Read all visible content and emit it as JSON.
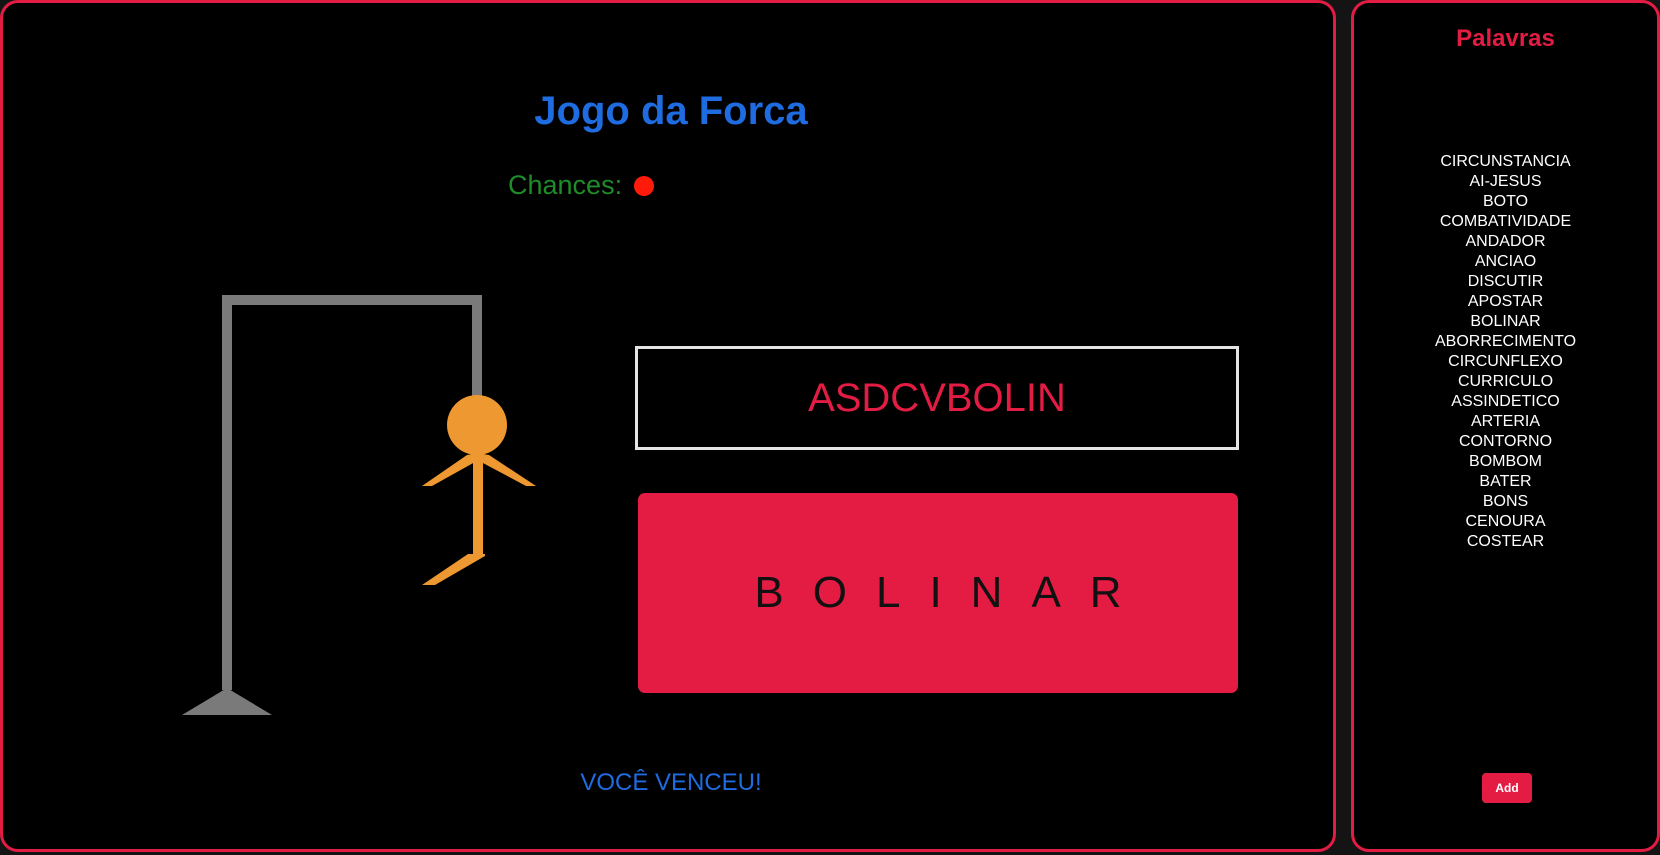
{
  "game": {
    "title": "Jogo da Forca",
    "chances_label": "Chances:",
    "chances_remaining": 1,
    "guessed_letters": "ASDCVBOLIN",
    "revealed_word": "BOLINAR",
    "result_message": "VOCÊ VENCEU!"
  },
  "sidebar": {
    "title": "Palavras",
    "words": [
      "CIRCUNSTANCIA",
      "AI-JESUS",
      "BOTO",
      "COMBATIVIDADE",
      "ANDADOR",
      "ANCIAO",
      "DISCUTIR",
      "APOSTAR",
      "BOLINAR",
      "ABORRECIMENTO",
      "CIRCUNFLEXO",
      "CURRICULO",
      "ASSINDETICO",
      "ARTERIA",
      "CONTORNO",
      "BOMBOM",
      "BATER",
      "BONS",
      "CENOURA",
      "COSTEAR"
    ],
    "add_label": "Add"
  },
  "colors": {
    "accent": "#e21c43",
    "title_blue": "#1f6be0",
    "chances_green": "#1f8c2a",
    "chance_dot": "#ff1a0a",
    "gallows_gray": "#7a7a7a",
    "figure_orange": "#ee9832"
  }
}
